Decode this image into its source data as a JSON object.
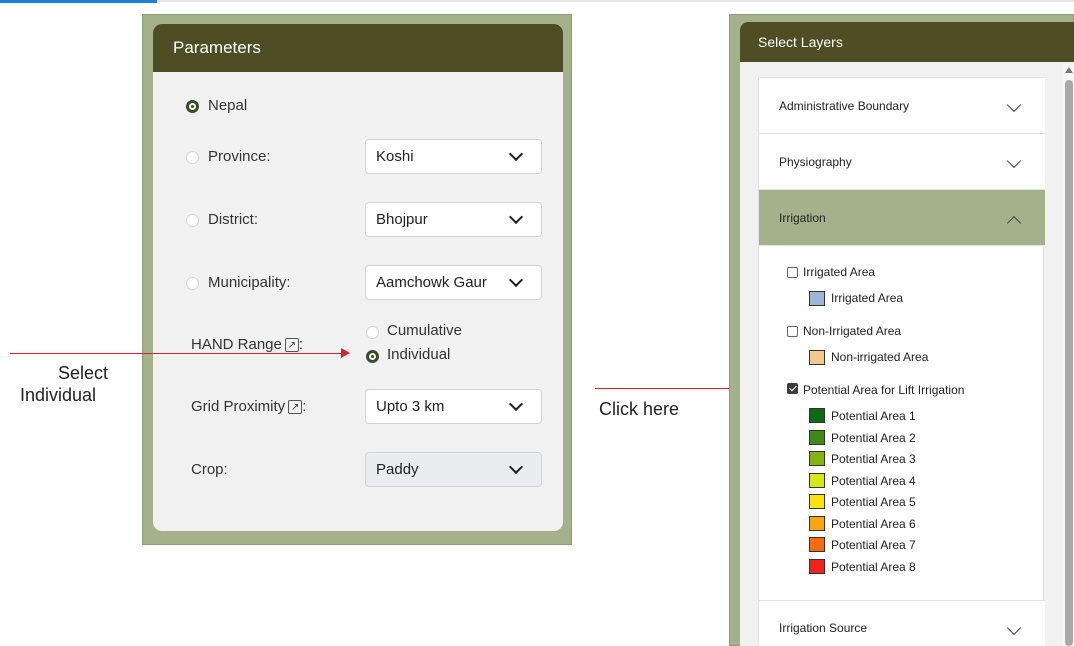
{
  "parameters": {
    "title": "Parameters",
    "nepal_label": "Nepal",
    "province": {
      "label": "Province:",
      "value": "Koshi"
    },
    "district": {
      "label": "District:",
      "value": "Bhojpur"
    },
    "municipality": {
      "label": "Municipality:",
      "value": "Aamchowk Gaur"
    },
    "hand_range": {
      "label": "HAND Range",
      "suffix": ":",
      "options": [
        "Cumulative",
        "Individual"
      ],
      "selected": "Individual"
    },
    "grid_proximity": {
      "label": "Grid Proximity",
      "suffix": ":",
      "value": "Upto 3 km"
    },
    "crop": {
      "label": "Crop:",
      "value": "Paddy"
    }
  },
  "annotations": {
    "select_individual_line1": "Select",
    "select_individual_line2": "Individual",
    "click_here": "Click here",
    "arrow_color": "#d6242e"
  },
  "layers": {
    "title": "Select Layers",
    "accordion": [
      {
        "label": "Administrative Boundary",
        "expanded": false
      },
      {
        "label": "Physiography",
        "expanded": false
      },
      {
        "label": "Irrigation",
        "expanded": true
      },
      {
        "label": "Irrigation Source",
        "expanded": false
      }
    ],
    "irrigation": {
      "irrigated": {
        "label": "Irrigated Area",
        "checked": false,
        "legend": "Irrigated Area",
        "color": "#9db6d8"
      },
      "non_irrigated": {
        "label": "Non-Irrigated Area",
        "checked": false,
        "legend": "Non-irrigated Area",
        "color": "#f3c98b"
      },
      "potential": {
        "label": "Potential Area for Lift Irrigation",
        "checked": true,
        "legend": [
          {
            "label": "Potential Area 1",
            "color": "#0a6b12"
          },
          {
            "label": "Potential Area 2",
            "color": "#3e8a12"
          },
          {
            "label": "Potential Area 3",
            "color": "#82b414"
          },
          {
            "label": "Potential Area 4",
            "color": "#d3e814"
          },
          {
            "label": "Potential Area 5",
            "color": "#fbe40b"
          },
          {
            "label": "Potential Area 6",
            "color": "#f9a50b"
          },
          {
            "label": "Potential Area 7",
            "color": "#f96a0b"
          },
          {
            "label": "Potential Area 8",
            "color": "#f2231a"
          }
        ]
      }
    }
  },
  "colors": {
    "header": "#4e4d23",
    "panel_border": "#a3b28b",
    "active_accordion": "#a3b28b"
  }
}
